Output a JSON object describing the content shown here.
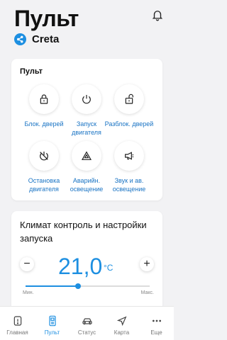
{
  "header": {
    "title": "Пульт",
    "car_name": "Creta"
  },
  "remote": {
    "title": "Пульт",
    "items": [
      {
        "label": "Блок. дверей",
        "icon": "lock-icon"
      },
      {
        "label": "Запуск двигателя",
        "icon": "power-icon"
      },
      {
        "label": "Разблок. дверей",
        "icon": "unlock-icon"
      },
      {
        "label": "Остановка двигателя",
        "icon": "power-off-icon"
      },
      {
        "label": "Аварийн. освещение",
        "icon": "hazard-icon"
      },
      {
        "label": "Звук и ав. освещение",
        "icon": "horn-icon"
      }
    ]
  },
  "climate": {
    "title": "Климат контроль и настройки запуска",
    "temperature": "21,0",
    "unit": "°C",
    "minus_label": "−",
    "plus_label": "+",
    "slider_min_label": "Мин.",
    "slider_max_label": "Макс.",
    "slider_level": 0.42
  },
  "nav": {
    "items": [
      {
        "label": "Главная",
        "icon": "home-icon"
      },
      {
        "label": "Пульт",
        "icon": "remote-icon",
        "active": true
      },
      {
        "label": "Статус",
        "icon": "car-icon"
      },
      {
        "label": "Карта",
        "icon": "navigation-icon"
      },
      {
        "label": "Еще",
        "icon": "more-icon"
      }
    ]
  },
  "colors": {
    "accent": "#1d8fe1",
    "label_blue": "#1a74c4",
    "background": "#f2f2f4"
  }
}
